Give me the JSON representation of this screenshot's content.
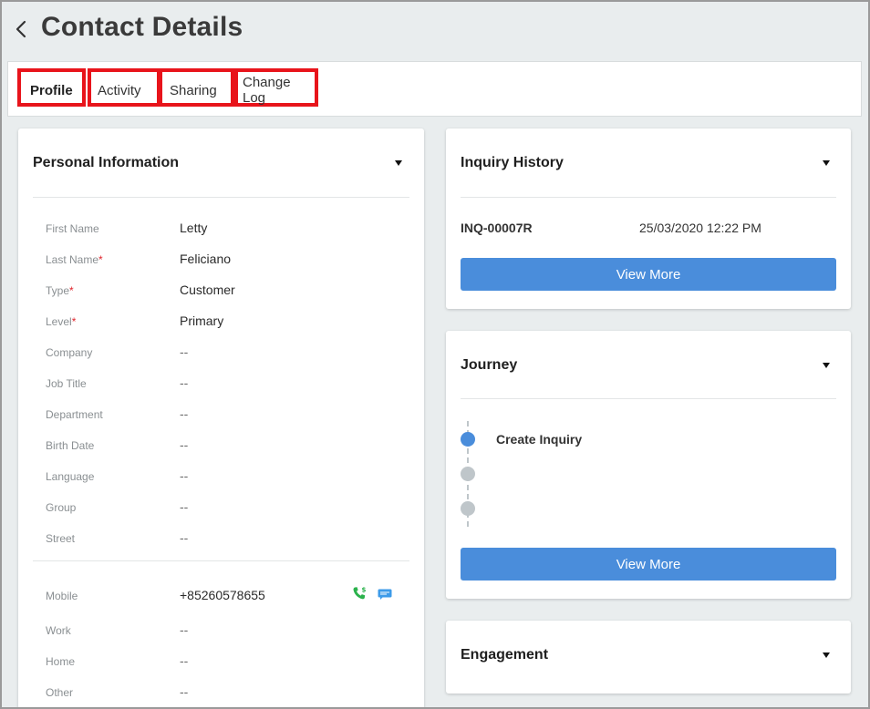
{
  "header": {
    "title": "Contact Details"
  },
  "tabs": [
    {
      "label": "Profile",
      "active": true
    },
    {
      "label": "Activity",
      "active": false
    },
    {
      "label": "Sharing",
      "active": false
    },
    {
      "label": "Change Log",
      "active": false
    }
  ],
  "personal_info": {
    "title": "Personal Information",
    "fields": [
      {
        "label": "First Name",
        "required": false,
        "value": "Letty"
      },
      {
        "label": "Last Name",
        "required": true,
        "value": "Feliciano"
      },
      {
        "label": "Type",
        "required": true,
        "value": "Customer"
      },
      {
        "label": "Level",
        "required": true,
        "value": "Primary"
      },
      {
        "label": "Company",
        "required": false,
        "value": "--"
      },
      {
        "label": "Job Title",
        "required": false,
        "value": "--"
      },
      {
        "label": "Department",
        "required": false,
        "value": "--"
      },
      {
        "label": "Birth Date",
        "required": false,
        "value": "--"
      },
      {
        "label": "Language",
        "required": false,
        "value": "--"
      },
      {
        "label": "Group",
        "required": false,
        "value": "--"
      },
      {
        "label": "Street",
        "required": false,
        "value": "--"
      }
    ],
    "contacts": [
      {
        "label": "Mobile",
        "value": "+85260578655"
      },
      {
        "label": "Work",
        "value": "--"
      },
      {
        "label": "Home",
        "value": "--"
      },
      {
        "label": "Other",
        "value": "--"
      }
    ],
    "required_mark": "*"
  },
  "inquiry_history": {
    "title": "Inquiry History",
    "items": [
      {
        "id": "INQ-00007R",
        "date": "25/03/2020 12:22 PM"
      }
    ],
    "view_more_label": "View More"
  },
  "journey": {
    "title": "Journey",
    "steps": [
      {
        "label": "Create Inquiry",
        "done": true
      },
      {
        "label": "",
        "done": false
      },
      {
        "label": "",
        "done": false
      }
    ],
    "view_more_label": "View More"
  },
  "engagement": {
    "title": "Engagement"
  },
  "colors": {
    "accent": "#4a8ddb",
    "tab_highlight": "#e8141b",
    "required": "#e0242c",
    "step_done": "#4a8ddb",
    "step_pending": "#bfc6ca",
    "phone_icon": "#2bb24c",
    "sms_icon": "#3d9be9"
  },
  "icons": {
    "back": "chevron-left-icon",
    "collapse": "caret-down-icon",
    "phone": "phone-call-icon",
    "sms": "sms-icon"
  }
}
